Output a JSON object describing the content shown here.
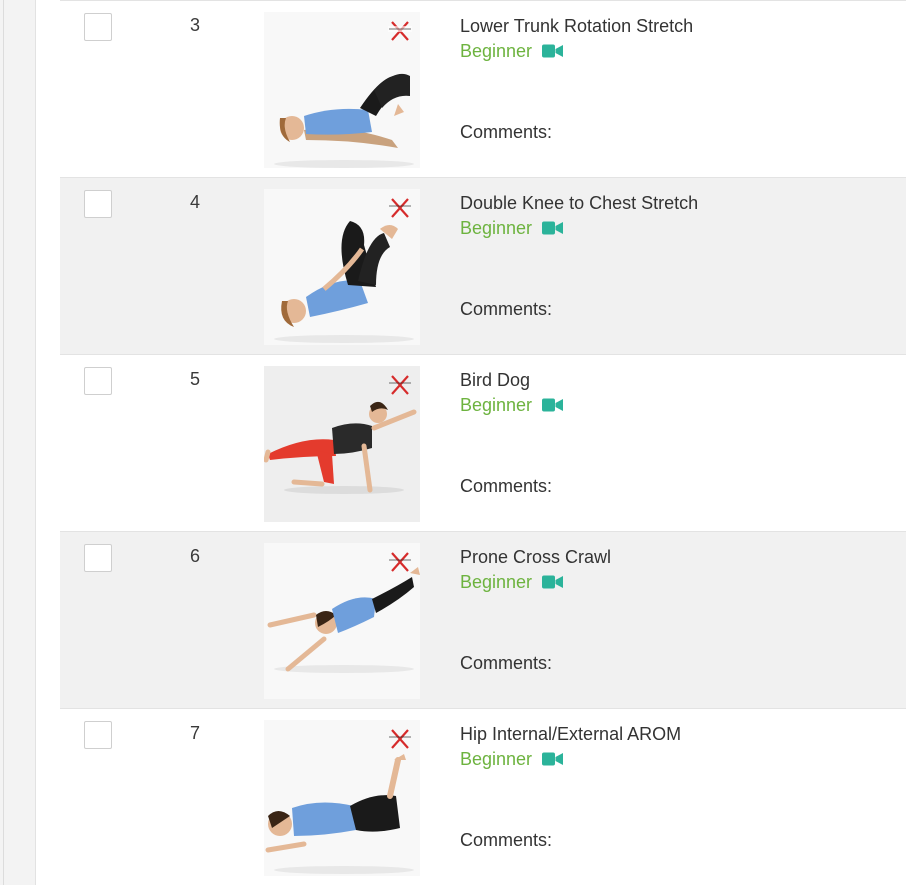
{
  "colors": {
    "level_green": "#6db33f",
    "video_icon": "#2bb39a",
    "alt_row_bg": "#f1f1f1"
  },
  "exercises": [
    {
      "number": "3",
      "name": "Lower Trunk Rotation Stretch",
      "level": "Beginner",
      "comments_label": "Comments:",
      "image_icon": "lower-trunk-rotation-photo"
    },
    {
      "number": "4",
      "name": "Double Knee to Chest Stretch",
      "level": "Beginner",
      "comments_label": "Comments:",
      "image_icon": "double-knee-to-chest-photo"
    },
    {
      "number": "5",
      "name": "Bird Dog",
      "level": "Beginner",
      "comments_label": "Comments:",
      "image_icon": "bird-dog-photo"
    },
    {
      "number": "6",
      "name": "Prone Cross Crawl",
      "level": "Beginner",
      "comments_label": "Comments:",
      "image_icon": "prone-cross-crawl-photo"
    },
    {
      "number": "7",
      "name": "Hip Internal/External AROM",
      "level": "Beginner",
      "comments_label": "Comments:",
      "image_icon": "hip-internal-external-arom-photo"
    }
  ]
}
